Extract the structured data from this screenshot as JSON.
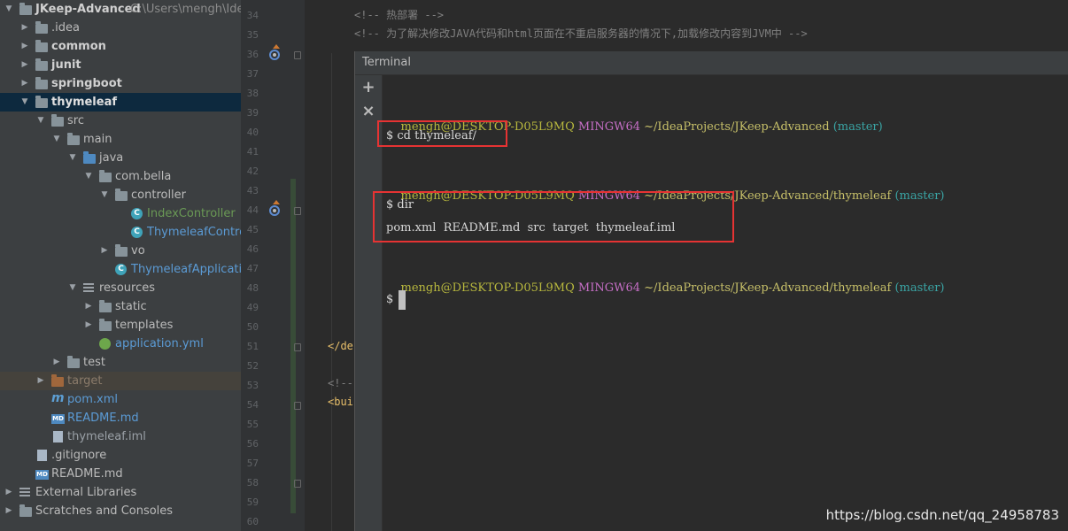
{
  "project": {
    "root_name": "JKeep-Advanced",
    "root_path": "C:\\Users\\mengh\\Idea",
    "items": [
      {
        "label": "JKeep-Advanced"
      },
      {
        "label": ".idea"
      },
      {
        "label": "common"
      },
      {
        "label": "junit"
      },
      {
        "label": "springboot"
      },
      {
        "label": "thymeleaf"
      },
      {
        "label": "src"
      },
      {
        "label": "main"
      },
      {
        "label": "java"
      },
      {
        "label": "com.bella"
      },
      {
        "label": "controller"
      },
      {
        "label": "IndexController"
      },
      {
        "label": "ThymeleafControll"
      },
      {
        "label": "vo"
      },
      {
        "label": "ThymeleafApplication"
      },
      {
        "label": "resources"
      },
      {
        "label": "static"
      },
      {
        "label": "templates"
      },
      {
        "label": "application.yml"
      },
      {
        "label": "test"
      },
      {
        "label": "target"
      },
      {
        "label": "pom.xml"
      },
      {
        "label": "README.md"
      },
      {
        "label": "thymeleaf.iml"
      },
      {
        "label": ".gitignore"
      },
      {
        "label": "README.md"
      },
      {
        "label": "External Libraries"
      },
      {
        "label": "Scratches and Consoles"
      }
    ]
  },
  "editor": {
    "line_numbers": [
      "34",
      "35",
      "36",
      "37",
      "38",
      "39",
      "40",
      "41",
      "42",
      "43",
      "44",
      "45",
      "46",
      "47",
      "48",
      "49",
      "50",
      "51",
      "52",
      "53",
      "54",
      "55",
      "56",
      "57",
      "58",
      "59",
      "60"
    ],
    "line34": "<!-- 热部署 -->",
    "line35": "<!-- 为了解决修改JAVA代码和html页面在不重启服务器的情况下,加载修改内容到JVM中 -->",
    "line51": "</de",
    "line53": "<!--",
    "line54": "<bui"
  },
  "terminal": {
    "title": "Terminal",
    "new_tab": "+",
    "close_tab": "×",
    "prompt1": {
      "user": "mengh@DESKTOP-D05L9MQ",
      "sys": "MINGW64",
      "path": "~/IdeaProjects/JKeep-Advanced",
      "branch": "(master)"
    },
    "cmd1": "$ cd thymeleaf/",
    "prompt2": {
      "user": "mengh@DESKTOP-D05L9MQ",
      "sys": "MINGW64",
      "path": "~/IdeaProjects/JKeep-Advanced/thymeleaf",
      "branch": "(master)"
    },
    "cmd2": "$ dir",
    "output2": "pom.xml  README.md  src  target  thymeleaf.iml",
    "prompt3": {
      "user": "mengh@DESKTOP-D05L9MQ",
      "sys": "MINGW64",
      "path": "~/IdeaProjects/JKeep-Advanced/thymeleaf",
      "branch": "(master)"
    },
    "cmd3": "$"
  },
  "watermark": "https://blog.csdn.net/qq_24958783",
  "colors": {
    "highlight_box": "#e63333",
    "selection": "#0d293e",
    "panel": "#3c3f41"
  }
}
